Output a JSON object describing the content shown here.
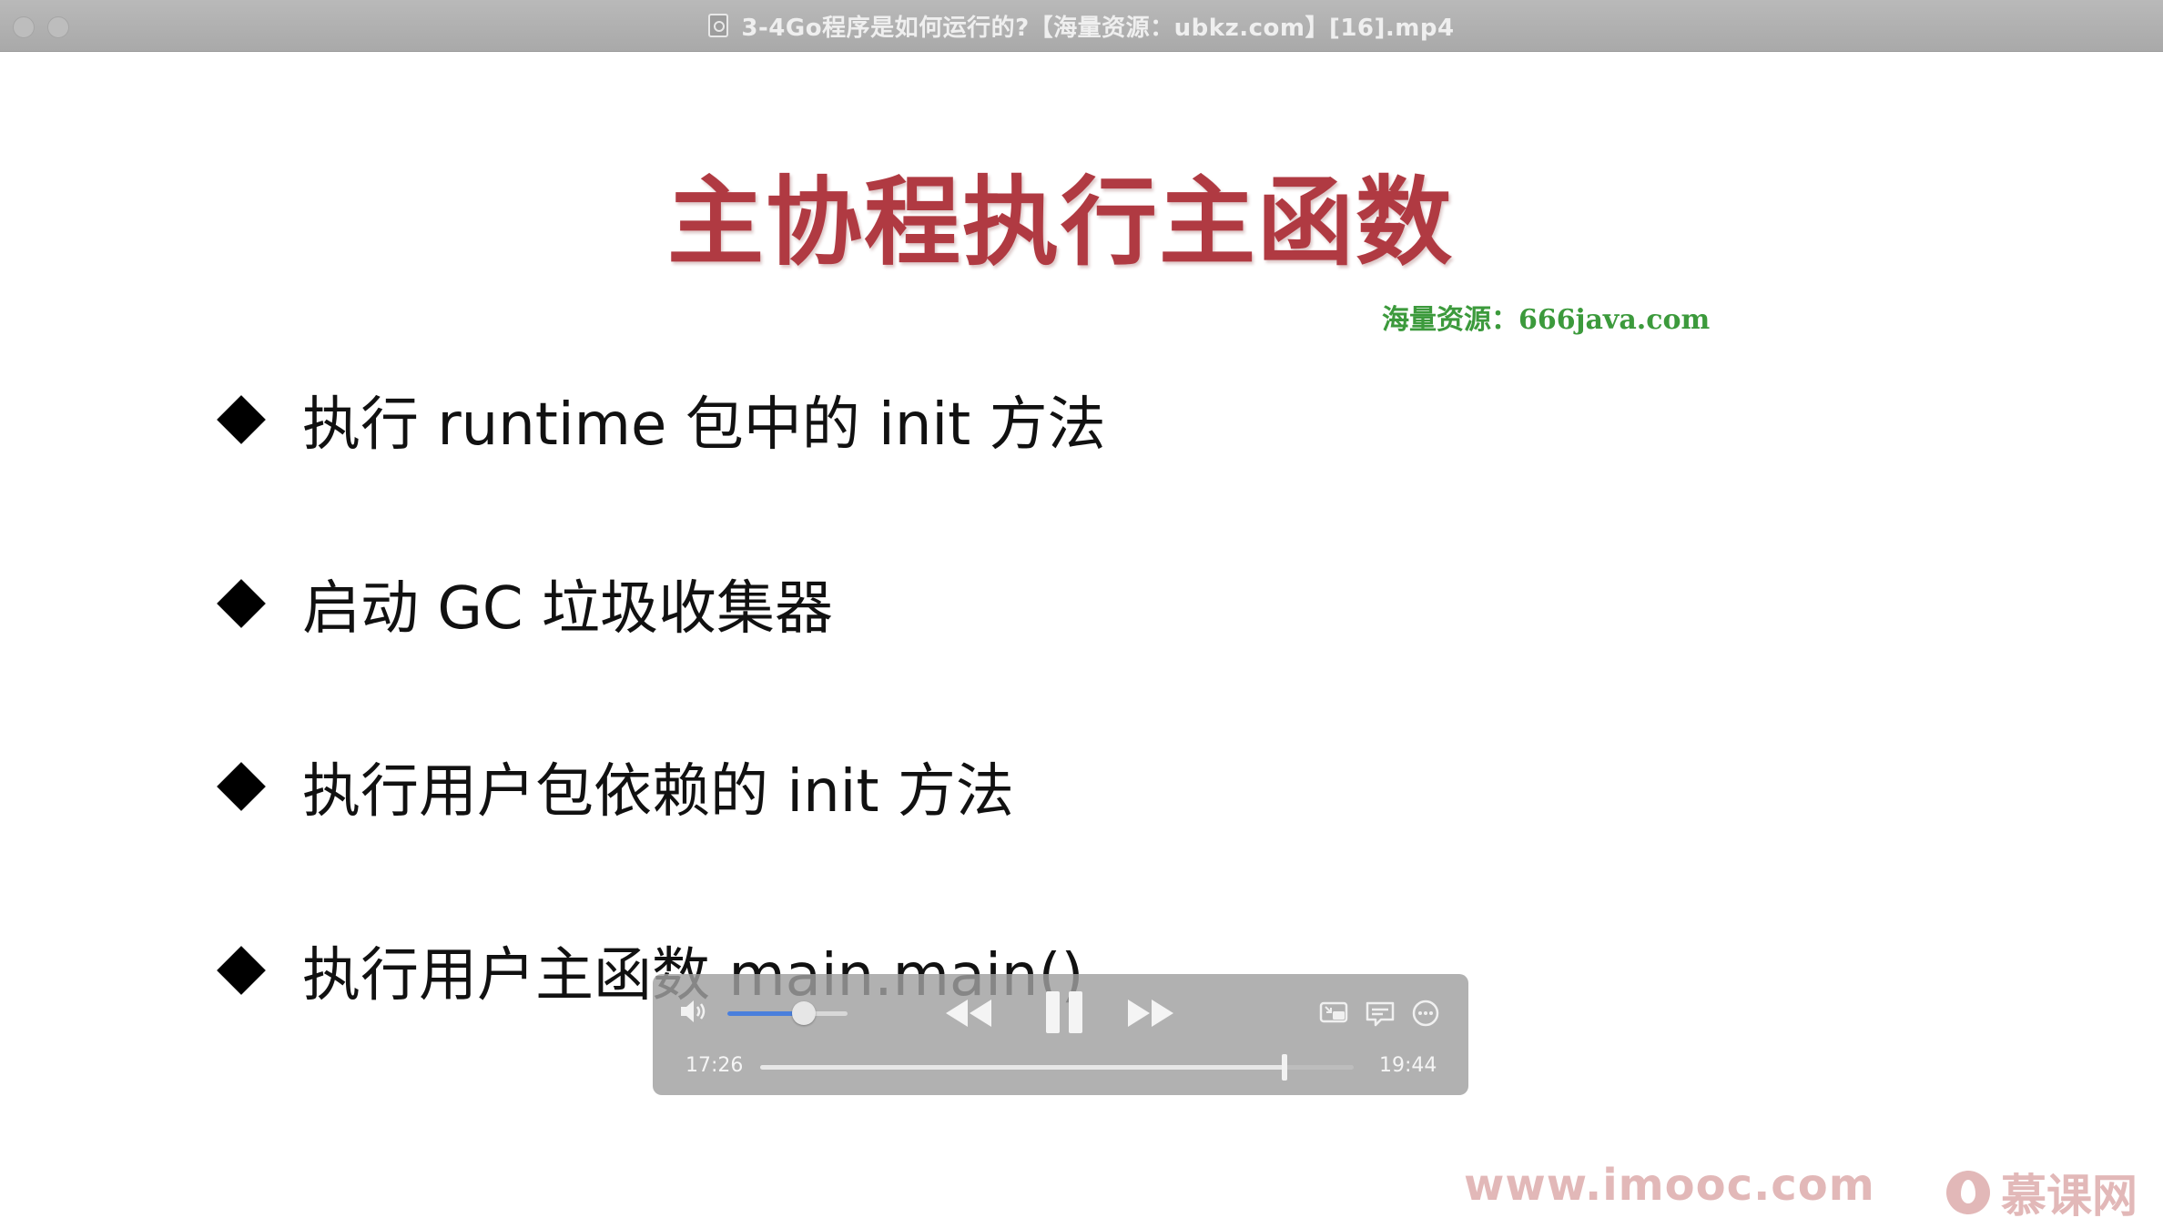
{
  "window": {
    "title": "3-4Go程序是如何运行的?【海量资源：ubkz.com】[16].mp4"
  },
  "slide": {
    "title": "主协程执行主函数",
    "watermark": "海量资源：666java.com",
    "bullets": [
      "执行 runtime 包中的 init 方法",
      "启动 GC 垃圾收集器",
      "执行用户包依赖的 init 方法",
      "执行用户主函数 main.main()"
    ]
  },
  "player": {
    "current_time": "17:26",
    "duration": "19:44",
    "volume_level": 0.64,
    "progress_fraction": 0.883,
    "accent_color": "#4a7fdc"
  },
  "footer": {
    "site_url": "www.imooc.com",
    "brand_name": "慕课网"
  }
}
